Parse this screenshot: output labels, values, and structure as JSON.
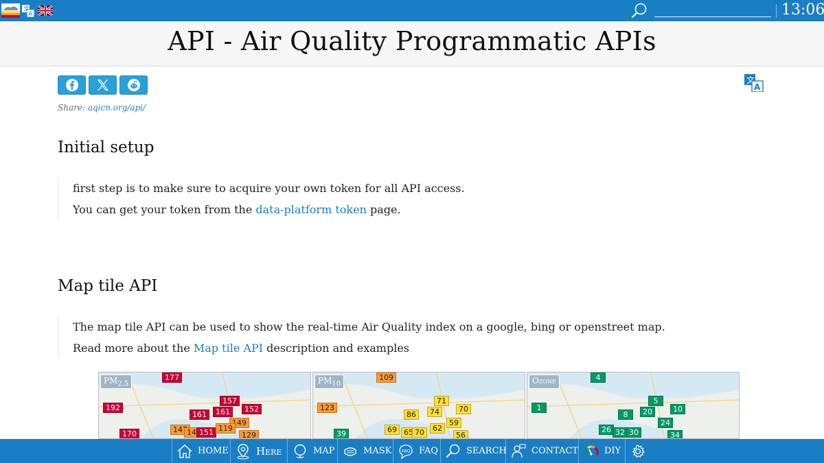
{
  "topbar": {
    "clock": "13:06",
    "search_value": ""
  },
  "page": {
    "title": "API - Air Quality Programmatic APIs",
    "share_prefix": "Share:",
    "share_link": "aqicn.org/api/"
  },
  "sections": [
    {
      "heading": "Initial setup",
      "line1": "first step is to make sure to acquire your own token for all API access.",
      "line2_before": "You can get your token from the ",
      "line2_link": "data-platform token",
      "line2_after": " page."
    },
    {
      "heading": "Map tile API",
      "line1": "The map tile API can be used to show the real-time Air Quality index on a google, bing or openstreet map.",
      "line2_before": "Read more about the ",
      "line2_link": "Map tile API",
      "line2_after": " description and examples"
    }
  ],
  "maps": [
    {
      "tag": "PM",
      "tag_sub": "2.5",
      "pins": [
        "177",
        "192",
        "157",
        "161",
        "161",
        "152",
        "149",
        "147",
        "14",
        "151",
        "119",
        "129",
        "170"
      ]
    },
    {
      "tag": "PM",
      "tag_sub": "10",
      "pins": [
        "109",
        "123",
        "71",
        "86",
        "74",
        "70",
        "69",
        "65",
        "70",
        "62",
        "59",
        "56",
        "39"
      ]
    },
    {
      "tag": "Ozone",
      "tag_sub": "",
      "pins": [
        "4",
        "1",
        "5",
        "8",
        "20",
        "10",
        "24",
        "26",
        "32",
        "30",
        "34"
      ]
    }
  ],
  "nav": [
    {
      "label": "HOME"
    },
    {
      "label": "Here"
    },
    {
      "label": "MAP"
    },
    {
      "label": "MASK"
    },
    {
      "label": "FAQ"
    },
    {
      "label": "SEARCH"
    },
    {
      "label": "CONTACT"
    },
    {
      "label": "DIY"
    },
    {
      "label": ""
    }
  ],
  "colors": {
    "brand_blue": "#1a7ec5",
    "share_blue": "#2aa0d8",
    "link_blue": "#1a7ec5",
    "aqi_unhealthy": "#cc0033",
    "aqi_sensitive": "#ff9933",
    "aqi_moderate": "#ffde33",
    "aqi_good": "#009966"
  }
}
